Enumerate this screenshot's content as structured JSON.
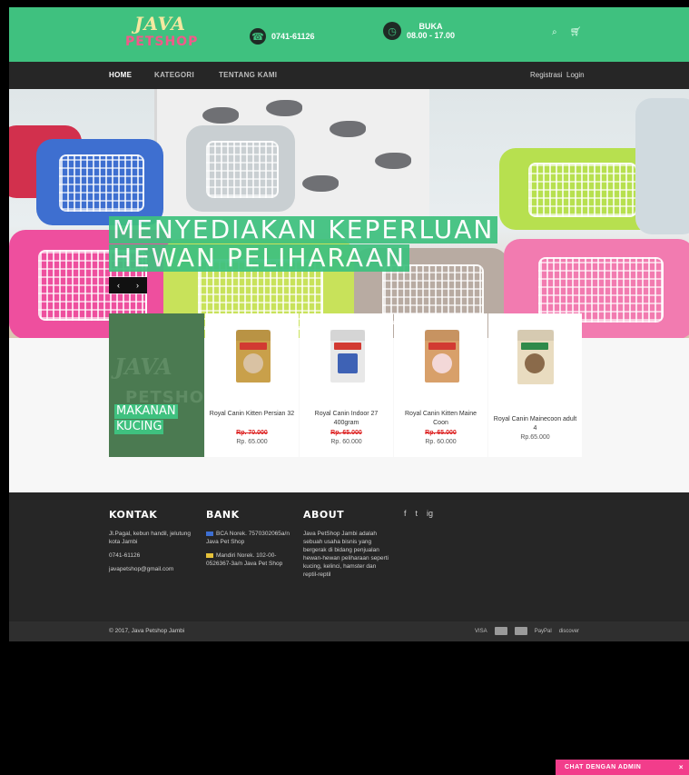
{
  "header": {
    "logo_line1": "JAVA",
    "logo_line2": "PETSHOP",
    "phone": "0741-61126",
    "hours_label": "BUKA",
    "hours_time": "08.00 - 17.00"
  },
  "icons": [
    "phone-icon",
    "clock-icon",
    "search-icon",
    "cart-icon",
    "facebook-icon",
    "twitter-icon",
    "instagram-icon",
    "chevron-left-icon",
    "chevron-right-icon"
  ],
  "nav": {
    "items": [
      {
        "label": "HOME"
      },
      {
        "label": "KATEGORI"
      },
      {
        "label": "TENTANG KAMI"
      }
    ],
    "register_label": "Registrasi",
    "login_label": "Login"
  },
  "hero": {
    "line1": "MENYEDIAKAN KEPERLUAN",
    "line2": "HEWAN PELIHARAAN"
  },
  "category": {
    "watermark1": "JAVA",
    "watermark2": "PETSHOP",
    "line1": "MAKANAN",
    "line2": "KUCING"
  },
  "products": [
    {
      "name": "Royal Canin Kitten Persian 32",
      "old_price": "Rp. 70.000",
      "price": "Rp. 65.000",
      "bag_color": "#c9a04a"
    },
    {
      "name": "Royal Canin Indoor 27 400gram",
      "old_price": "Rp. 65.000",
      "price": "Rp. 60.000",
      "bag_color": "#e8e8e8"
    },
    {
      "name": "Royal Canin Kitten Maine Coon",
      "old_price": "Rp. 65.000",
      "price": "Rp. 60.000",
      "bag_color": "#d8a06a"
    },
    {
      "name": "Royal Canin Mainecoon adult 4",
      "old_price": "",
      "price": "Rp.65.000",
      "bag_color": "#e9dcc0"
    }
  ],
  "footer": {
    "kontak": {
      "title": "KONTAK",
      "address": "Jl.Pagal, kebun handil, jelutung kota Jambi",
      "phone": "0741-61126",
      "email": "javapetshop@gmail.com"
    },
    "bank": {
      "title": "BANK",
      "bca": "BCA Norek. 7570302065a/n Java Pet Shop",
      "mandiri": "Mandiri Norek. 102-00-0526367-3a/n Java Pet Shop"
    },
    "about": {
      "title": "ABOUT",
      "text": "Java PetShop Jambi adalah sebuah usaha bisnis yang bergerak di bidang penjualan hewan-hewan peliharaan seperti kucing, kelinci, hamster dan reptil-reptil"
    },
    "social": [
      "f",
      "t",
      "ig"
    ],
    "copyright": "© 2017, Java Petshop Jambi",
    "payments": [
      "VISA",
      "mastercard",
      "PayPal",
      "discover"
    ]
  },
  "chat": {
    "label": "CHAT DENGAN ADMIN",
    "close": "×"
  },
  "colors": {
    "brand_green": "#3fc17f",
    "nav_dark": "#262626",
    "chat_pink": "#f23d8b",
    "category_green": "#4b7a51"
  }
}
